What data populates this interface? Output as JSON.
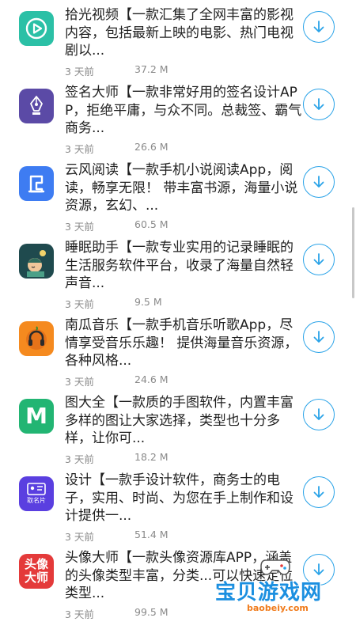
{
  "apps": [
    {
      "icon": "play-icon",
      "color": "#2bc0a6",
      "description": "拾光视频【一款汇集了全网丰富的影视内容，包括最新上映的电影、热门电视剧以...",
      "time": "3 天前",
      "size": "37.2 M"
    },
    {
      "icon": "pen-icon",
      "color": "#5b4aa6",
      "description": "签名大师【一款非常好用的签名设计APP，拒绝平庸，与众不同。总裁签、霸气商务...",
      "time": "3 天前",
      "size": "26.6 M"
    },
    {
      "icon": "book-icon",
      "color": "#3e7cf2",
      "description": "云风阅读【一款手机小说阅读App，阅读，畅享无限！ 带丰富书源，海量小说资源，玄幻、...",
      "time": "3 天前",
      "size": "60.5 M"
    },
    {
      "icon": "sleep-icon",
      "color": "#1f4a4e",
      "description": "睡眠助手【一款专业实用的记录睡眠的生活服务软件平台，收录了海量自然轻声音...",
      "time": "3 天前",
      "size": "9.5 M"
    },
    {
      "icon": "headphones-icon",
      "color": "#f58a1f",
      "description": "南瓜音乐【一款手机音乐听歌App，尽情享受音乐乐趣！ 提供海量音乐资源，各种风格...",
      "time": "3 天前",
      "size": "24.6 M"
    },
    {
      "icon": "letter-m-icon",
      "color": "#22b573",
      "glyph": "M",
      "description": "图大全【一款质的手图软件，内置丰富多样的图让大家选择，类型也十分多样，让你可...",
      "time": "3 天前",
      "size": "18.2 M"
    },
    {
      "icon": "card-icon",
      "color": "#5a3fe0",
      "glyph": "取名片",
      "description": "设计【一款手设计软件，商务士的电子，实用、时尚、为您在手上制作和设计提供一...",
      "time": "3 天前",
      "size": "51.4 M"
    },
    {
      "icon": "avatar-text-icon",
      "color": "#e43a3a",
      "glyph": "头像\n大师",
      "description": "头像大师【一款头像资源库APP，涵盖的头像类型丰富，分类...可以快速定位类型...",
      "time": "3 天前",
      "size": "99.5 M"
    }
  ],
  "watermark": {
    "text": "宝贝游戏网",
    "url": "baobeiy.com"
  },
  "colors": {
    "accent": "#2aa3e8",
    "meta": "#8a8a8a"
  }
}
